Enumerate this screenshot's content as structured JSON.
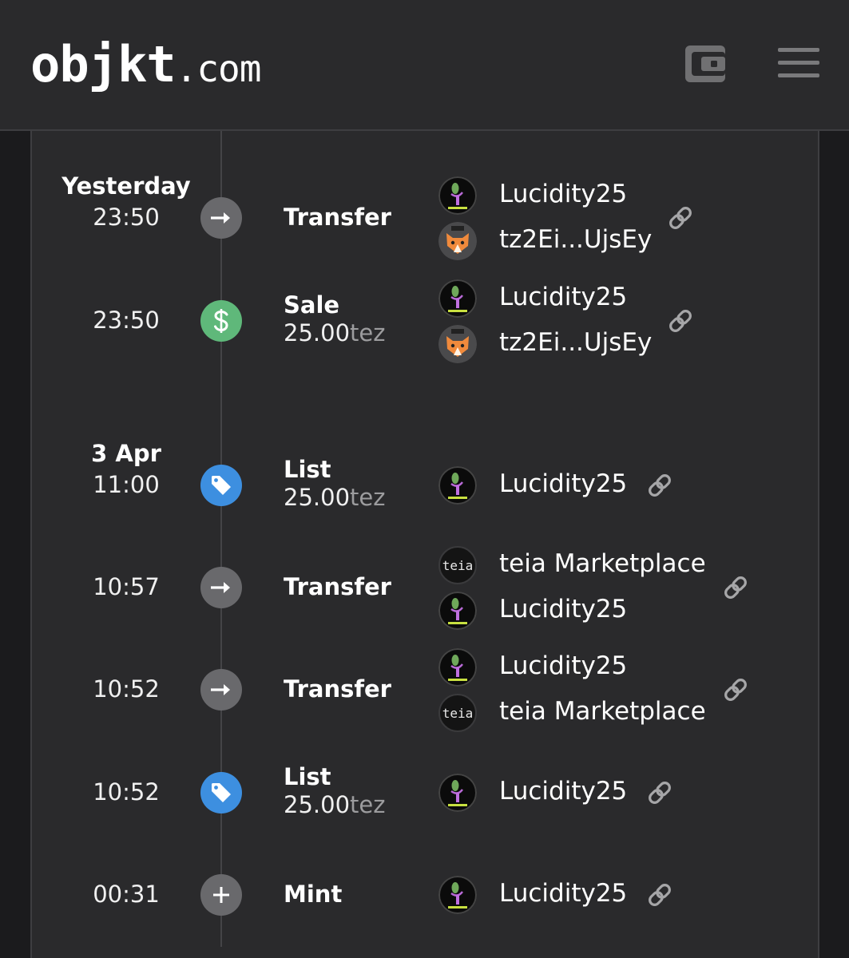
{
  "header": {
    "logo_main": "objkt",
    "logo_suffix": ".com",
    "wallet_icon": "wallet-icon",
    "menu_icon": "hamburger-menu-icon"
  },
  "colors": {
    "background": "#1b1b1d",
    "panel": "#2a2a2c",
    "transfer_icon": "#69696c",
    "sale_icon": "#5fb87a",
    "list_icon": "#3d8fe0",
    "price_unit": "#9c9c9e"
  },
  "history": [
    {
      "date": "Yesterday",
      "time": "23:50",
      "type": "Transfer",
      "icon": "arrow-right-icon",
      "price": null,
      "unit": null,
      "users": [
        {
          "name": "Lucidity25",
          "avatar": "lucidity-avatar"
        },
        {
          "name": "tz2Ei...UjsEy",
          "avatar": "fox-avatar"
        }
      ]
    },
    {
      "date": null,
      "time": "23:50",
      "type": "Sale",
      "icon": "dollar-icon",
      "price": "25.00",
      "unit": "tez",
      "users": [
        {
          "name": "Lucidity25",
          "avatar": "lucidity-avatar"
        },
        {
          "name": "tz2Ei...UjsEy",
          "avatar": "fox-avatar"
        }
      ]
    },
    {
      "date": "3 Apr",
      "time": "11:00",
      "type": "List",
      "icon": "tag-icon",
      "price": "25.00",
      "unit": "tez",
      "users": [
        {
          "name": "Lucidity25",
          "avatar": "lucidity-avatar"
        }
      ]
    },
    {
      "date": null,
      "time": "10:57",
      "type": "Transfer",
      "icon": "arrow-right-icon",
      "price": null,
      "unit": null,
      "users": [
        {
          "name": "teia Marketplace",
          "avatar": "teia-avatar",
          "avatar_text": "teia"
        },
        {
          "name": "Lucidity25",
          "avatar": "lucidity-avatar"
        }
      ]
    },
    {
      "date": null,
      "time": "10:52",
      "type": "Transfer",
      "icon": "arrow-right-icon",
      "price": null,
      "unit": null,
      "users": [
        {
          "name": "Lucidity25",
          "avatar": "lucidity-avatar"
        },
        {
          "name": "teia Marketplace",
          "avatar": "teia-avatar",
          "avatar_text": "teia"
        }
      ]
    },
    {
      "date": null,
      "time": "10:52",
      "type": "List",
      "icon": "tag-icon",
      "price": "25.00",
      "unit": "tez",
      "users": [
        {
          "name": "Lucidity25",
          "avatar": "lucidity-avatar"
        }
      ]
    },
    {
      "date": null,
      "time": "00:31",
      "type": "Mint",
      "icon": "plus-icon",
      "price": null,
      "unit": null,
      "users": [
        {
          "name": "Lucidity25",
          "avatar": "lucidity-avatar"
        }
      ]
    }
  ]
}
